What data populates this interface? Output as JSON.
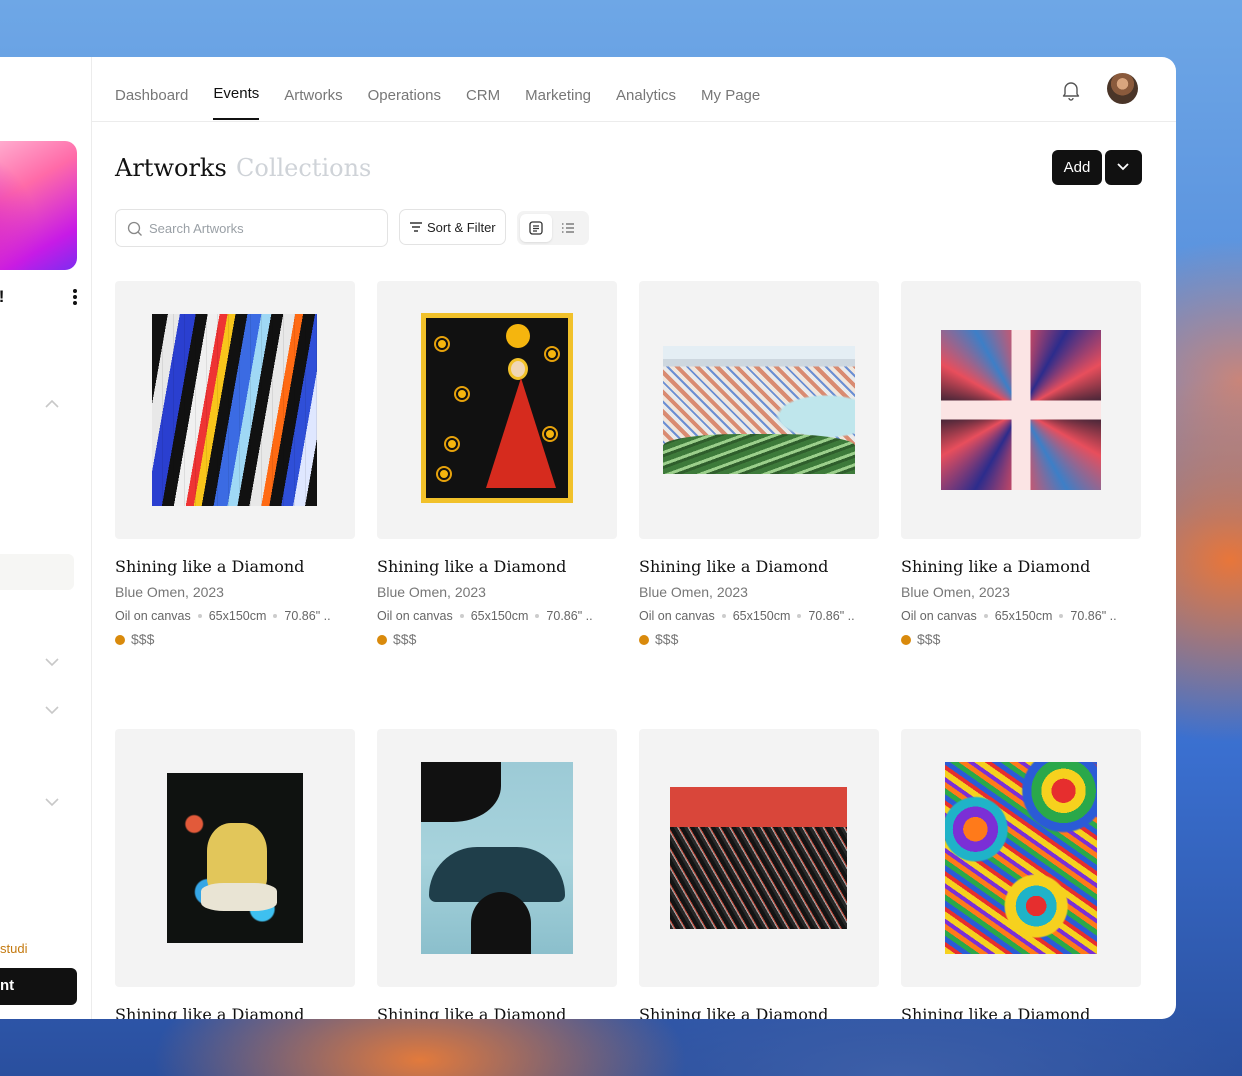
{
  "nav": {
    "tabs": [
      "Dashboard",
      "Events",
      "Artworks",
      "Operations",
      "CRM",
      "Marketing",
      "Analytics",
      "My Page"
    ],
    "active_tab": "Events",
    "icons": {
      "notifications": "bell-icon",
      "profile": "avatar"
    }
  },
  "sidebar": {
    "name_fragment": "l!",
    "studio_fragment": "studi",
    "button_fragment": "nt"
  },
  "header": {
    "title": "Artworks",
    "secondary": "Collections",
    "add_label": "Add"
  },
  "toolbar": {
    "search_placeholder": "Search Artworks",
    "sort_filter_label": "Sort & Filter"
  },
  "colors": {
    "price_dot": "#d98a0c",
    "primary_button": "#111111"
  },
  "artworks": [
    {
      "title": "Shining like a Diamond",
      "artist": "Blue Omen, 2023",
      "medium": "Oil on canvas",
      "size": "65x150cm",
      "extra": "70.86\" ..",
      "price": "$$$"
    },
    {
      "title": "Shining like a Diamond",
      "artist": "Blue Omen, 2023",
      "medium": "Oil on canvas",
      "size": "65x150cm",
      "extra": "70.86\" ..",
      "price": "$$$"
    },
    {
      "title": "Shining like a Diamond",
      "artist": "Blue Omen, 2023",
      "medium": "Oil on canvas",
      "size": "65x150cm",
      "extra": "70.86\" ..",
      "price": "$$$"
    },
    {
      "title": "Shining like a Diamond",
      "artist": "Blue Omen, 2023",
      "medium": "Oil on canvas",
      "size": "65x150cm",
      "extra": "70.86\" ..",
      "price": "$$$"
    },
    {
      "title": "Shining like a Diamond"
    },
    {
      "title": "Shining like a Diamond"
    },
    {
      "title": "Shining like a Diamond"
    },
    {
      "title": "Shining like a Diamond"
    }
  ]
}
